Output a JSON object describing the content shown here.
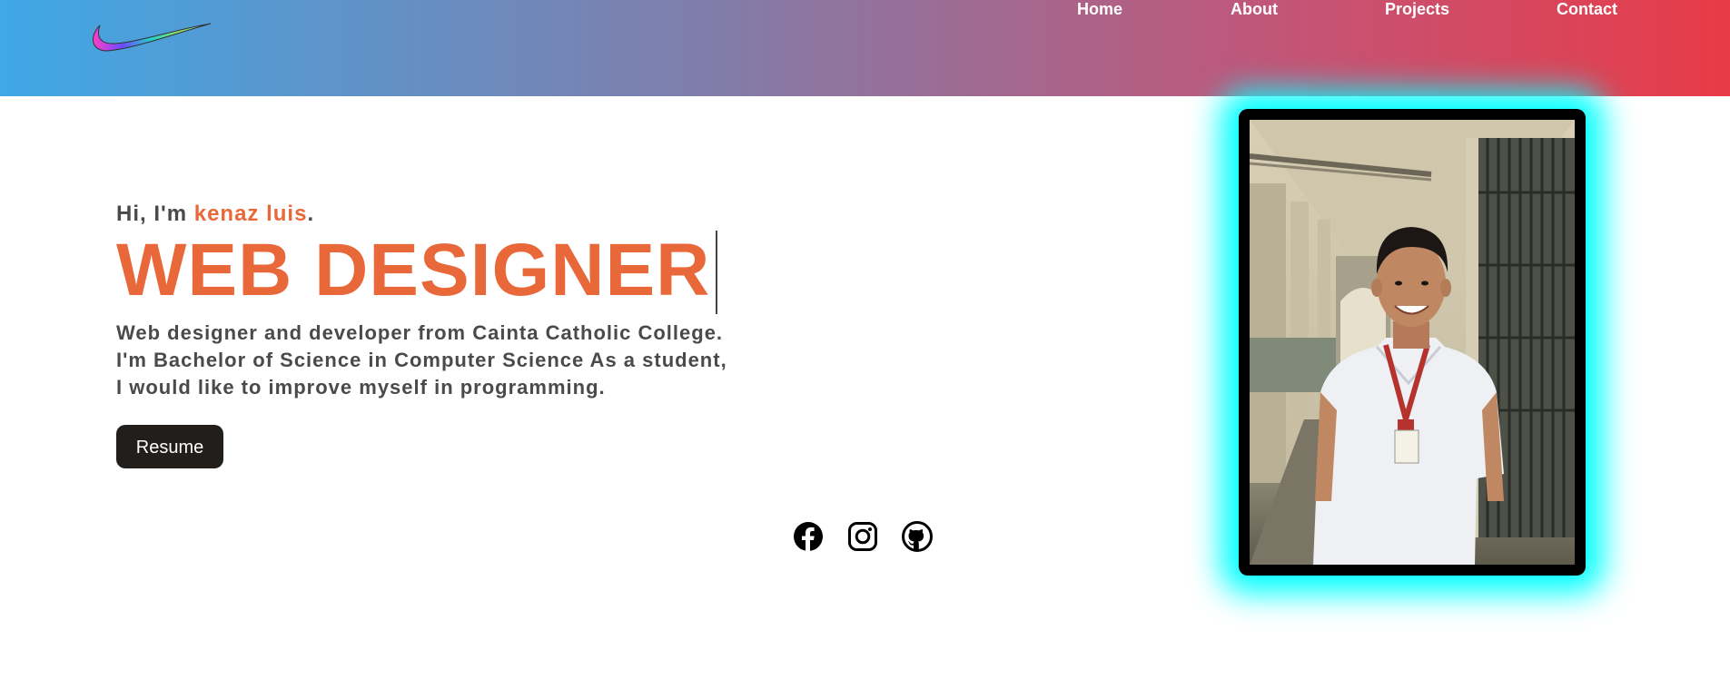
{
  "nav": {
    "items": [
      "Home",
      "About",
      "Projects",
      "Contact"
    ]
  },
  "hero": {
    "greeting_prefix": "Hi, I'm ",
    "name": "kenaz luis",
    "greeting_suffix": ".",
    "role": "WEB DESIGNER",
    "bio_lines": [
      "Web designer and developer from Cainta Catholic College.",
      "I'm Bachelor of Science in Computer Science As a student,",
      "I would like to improve myself in programming."
    ],
    "resume_label": "Resume"
  },
  "socials": [
    "facebook-icon",
    "instagram-icon",
    "github-icon"
  ],
  "colors": {
    "accent": "#e8683a",
    "text": "#4a4a4a",
    "button": "#221e1b",
    "glow": "#00ffff",
    "header_start": "#3fa8e6",
    "header_end": "#e83b47"
  }
}
